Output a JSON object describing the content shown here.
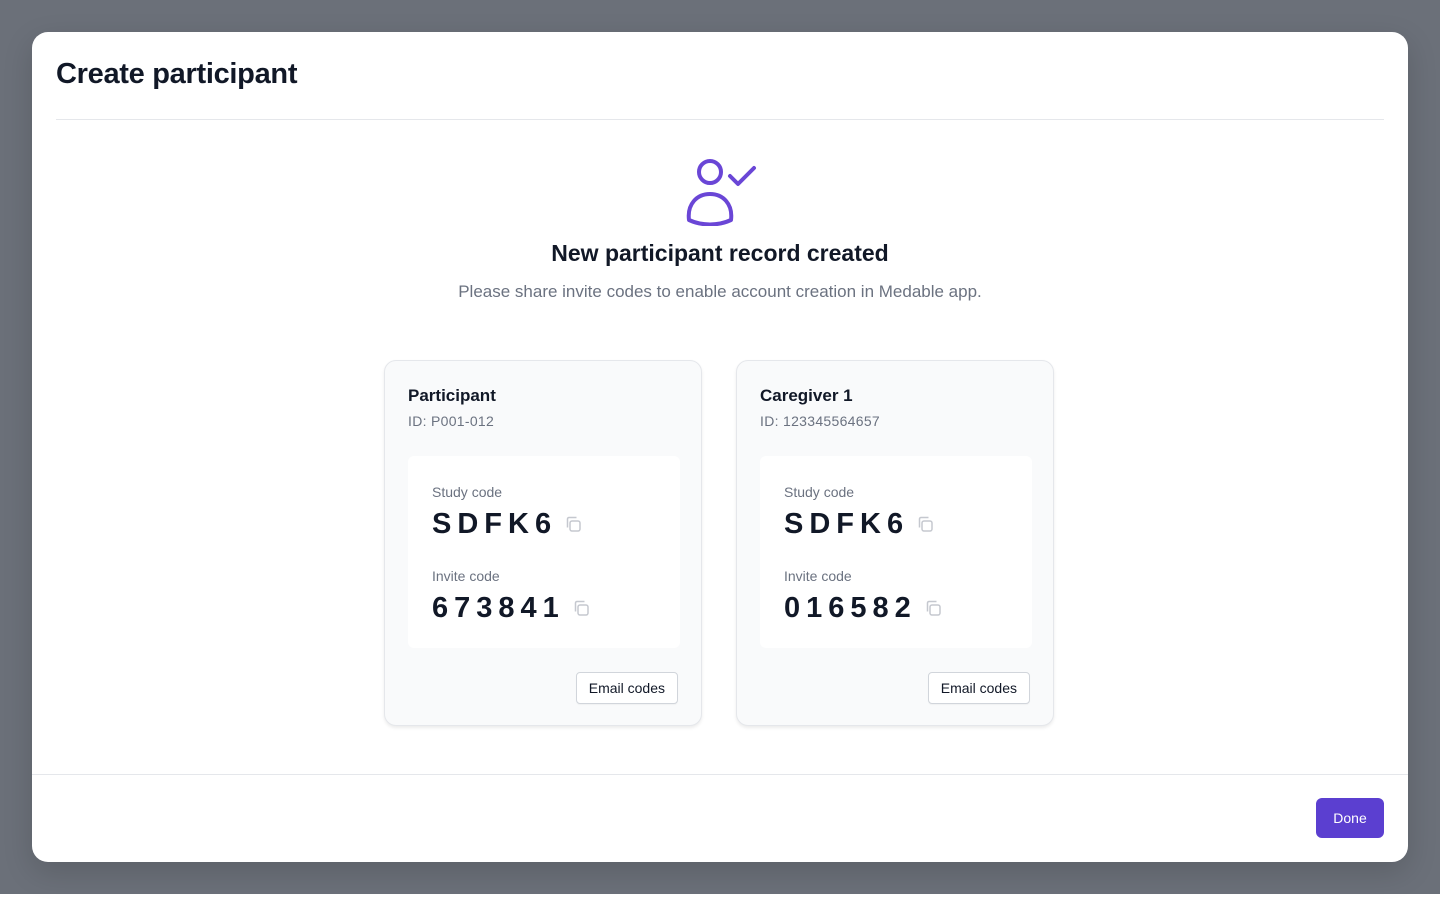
{
  "modal": {
    "title": "Create participant"
  },
  "success": {
    "icon": "user-check-icon",
    "heading": "New participant record created",
    "subtext": "Please share invite codes to enable account creation in Medable app."
  },
  "cards": [
    {
      "name": "Participant",
      "id_text": "ID: P001-012",
      "study_code_label": "Study code",
      "study_code": "SDFK6",
      "invite_code_label": "Invite code",
      "invite_code": "673841",
      "email_button": "Email codes"
    },
    {
      "name": "Caregiver 1",
      "id_text": "ID: 123345564657",
      "study_code_label": "Study code",
      "study_code": "SDFK6",
      "invite_code_label": "Invite code",
      "invite_code": "016582",
      "email_button": "Email codes"
    }
  ],
  "footer": {
    "done_label": "Done"
  },
  "colors": {
    "accent": "#5b3fd0",
    "icon_accent": "#6a46d6",
    "backdrop": "#6b7079"
  }
}
